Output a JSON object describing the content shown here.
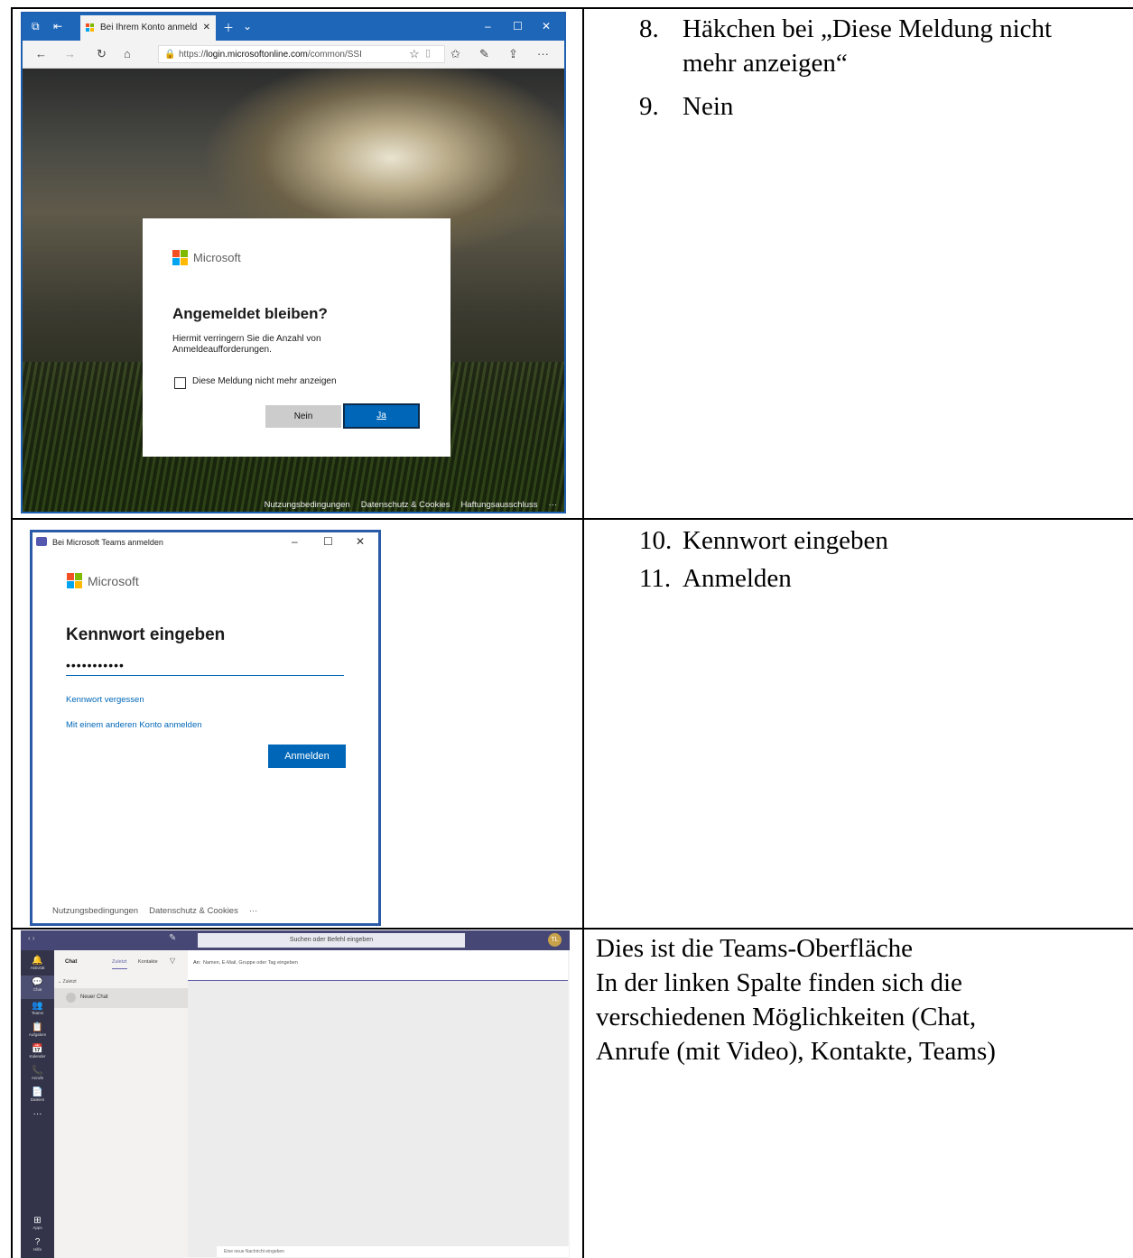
{
  "row1": {
    "browser": {
      "tab_title": "Bei Ihrem Konto anmeld",
      "url_prefix": "https://",
      "url_host": "login.microsoftonline.com",
      "url_rest": "/common/SSI",
      "footer_links": [
        "Nutzungsbedingungen",
        "Datenschutz & Cookies",
        "Haftungsausschluss",
        "···"
      ]
    },
    "dialog": {
      "brand": "Microsoft",
      "title": "Angemeldet bleiben?",
      "description": "Hiermit verringern Sie die Anzahl von Anmeldeaufforderungen.",
      "checkbox_label": "Diese Meldung nicht mehr anzeigen",
      "no_button": "Nein",
      "yes_button": "Ja"
    },
    "steps": [
      {
        "num": "8.",
        "lines": [
          "Häkchen bei „Diese Meldung nicht",
          "mehr anzeigen“"
        ]
      },
      {
        "num": "9.",
        "lines": [
          "Nein"
        ]
      }
    ]
  },
  "row2": {
    "window_title": "Bei Microsoft Teams anmelden",
    "brand": "Microsoft",
    "title": "Kennwort eingeben",
    "password_mask": "•••••••••••",
    "forgot_link": "Kennwort vergessen",
    "other_account_link": "Mit einem anderen Konto anmelden",
    "login_button": "Anmelden",
    "footer_links": [
      "Nutzungsbedingungen",
      "Datenschutz & Cookies",
      "···"
    ],
    "steps": [
      {
        "num": "10.",
        "text": "Kennwort eingeben"
      },
      {
        "num": "11.",
        "text": "Anmelden"
      }
    ]
  },
  "row3": {
    "search_placeholder": "Suchen oder Befehl eingeben",
    "avatar_initials": "TL",
    "rail": [
      {
        "glyph": "🔔",
        "label": "Aktivität"
      },
      {
        "glyph": "💬",
        "label": "Chat"
      },
      {
        "glyph": "👥",
        "label": "Teams"
      },
      {
        "glyph": "📋",
        "label": "Aufgaben"
      },
      {
        "glyph": "📅",
        "label": "Kalender"
      },
      {
        "glyph": "📞",
        "label": "Anrufe"
      },
      {
        "glyph": "📄",
        "label": "Dateien"
      },
      {
        "glyph": "···",
        "label": ""
      },
      {
        "glyph": "⊞",
        "label": "Apps"
      },
      {
        "glyph": "?",
        "label": "Hilfe"
      }
    ],
    "list_title": "Chat",
    "list_tabs": [
      "Zuletzt",
      "Kontakte"
    ],
    "section_label": "⌄ Zuletzt",
    "new_chat": "Neuer Chat",
    "to_label": "An:",
    "to_placeholder": "Namen, E-Mail, Gruppe oder Tag eingeben",
    "message_placeholder": "Eine neue Nachricht eingeben",
    "description_lines": [
      "Dies ist die Teams-Oberfläche",
      "In der linken Spalte finden sich die",
      "verschiedenen Möglichkeiten (Chat,",
      "Anrufe (mit Video), Kontakte, Teams)"
    ]
  }
}
